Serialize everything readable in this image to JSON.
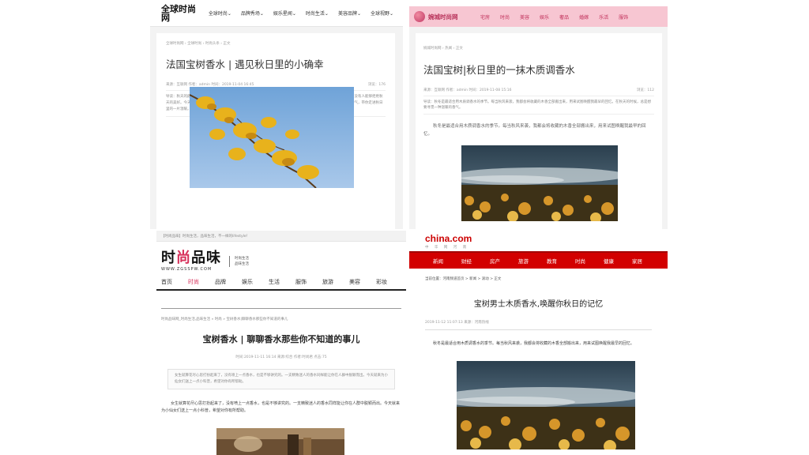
{
  "panel1": {
    "logo": "全球时尚网",
    "nav": [
      "全球时尚⌄",
      "品牌秀场⌄",
      "娱乐星闻⌄",
      "时尚生活⌄",
      "美容品牌⌄",
      "全球视野⌄"
    ],
    "breadcrumb": "全球时尚网 › 全球时尚 › 时尚头条 › 正文",
    "title": "法国宝树香水 | 遇见秋日里的小确幸",
    "meta_left": "来源：互联网    作者：admin    时间：2019-11-04 16:45",
    "meta_right": "浏览：176",
    "summary": "导读：秋天的颜色是被镀过了色彩，秋叶随风起舞之时，是秋天最美的时刻。美好的事物，总是需要时间去等待去发现。没有人能够拒绝秋天的美好。今天，就让我们一起来感受秋日的小确幸吧，感受属于秋天的独特味道。来自法国的宝树香水，用木质调的香气，带你走进秋日里的一片温暖。"
  },
  "panel2": {
    "logo": "婉城时尚网",
    "nav": [
      "宅房",
      "时尚",
      "美容",
      "娱乐",
      "奢品",
      "婚嫁",
      "乐活",
      "服饰"
    ],
    "breadcrumb": "婉城时尚网 › 热闻 › 正文",
    "title": "法国宝树|秋日里的一抹木质调香水",
    "meta_left": "来源：互联网    作者：admin    时间：2019-11-08 15:16",
    "meta_right": "浏览：112",
    "summary": "导读：秋冬是最适合用木质调香水的季节。每当秋风来袭，我都会将收藏的木香全部搬出来，用来试图唤醒我最早的回忆。在秋天的时候，总是想要寻觅一种温暖的香气。",
    "para": "秋冬是最适合用木质调香水的季节。每当秋风来袭，我都会将收藏的木香全部搬出来，用来试图唤醒我最早的回忆。"
  },
  "panel3": {
    "topbar": "【时尚品味】时尚生活，品味生活，不一样的lifestyle！",
    "brand": "时尚品味",
    "brand_sub": "WWW.ZGSSPW.COM",
    "slogan_1": "时尚生活",
    "slogan_2": "品味生活",
    "nav": [
      "首页",
      "时尚",
      "品牌",
      "娱乐",
      "生活",
      "服饰",
      "旅游",
      "美容",
      "彩妆"
    ],
    "active_nav": "时尚",
    "breadcrumb": "时尚品味网_时尚生活,品味生活  » 时尚  » 宝树香水|聊聊香水那些你不知道的事儿",
    "title": "宝树香水 | 聊聊香水那些你不知道的事儿",
    "meta": "时间:2019-11-11 16:14    来源:综合    作者:时尚君    点击:75",
    "summary": "女生就算花尽心思打扮起来了，没有喷上一点香水，也是不够讲究的。一支精致迷人的香水同样能让你在人群中脱颖而出。今天就来为小仙女们送上一点小科普，希望对你有所帮助。",
    "para": "女生就算花尽心思打扮起来了，没有喷上一点香水，也是不够讲究的。一支精致迷人的香水同样能让你在人群中脱颖而出。今天就来为小仙女们送上一点小科普，希望对你有所帮助。"
  },
  "panel4": {
    "logo": "china",
    "logo_suffix": ".com",
    "logo_sub": "中 华 网 河 南",
    "nav": [
      "新闻",
      "财经",
      "房产",
      "旅游",
      "教育",
      "时尚",
      "健康",
      "家居"
    ],
    "breadcrumb": "当前位置：河南频道首页  >  新闻  >  滚动  >  正文",
    "title": "宝树男士木质香水,唤醒你秋日的记忆",
    "meta": "2019-11-12 11:07:13    来源：河南热线",
    "para": "秋冬是最适合用木质调香水的季节。每当秋风来袭，我都会将收藏的木香全部搬出来，用来试图唤醒我最早的回忆。"
  }
}
